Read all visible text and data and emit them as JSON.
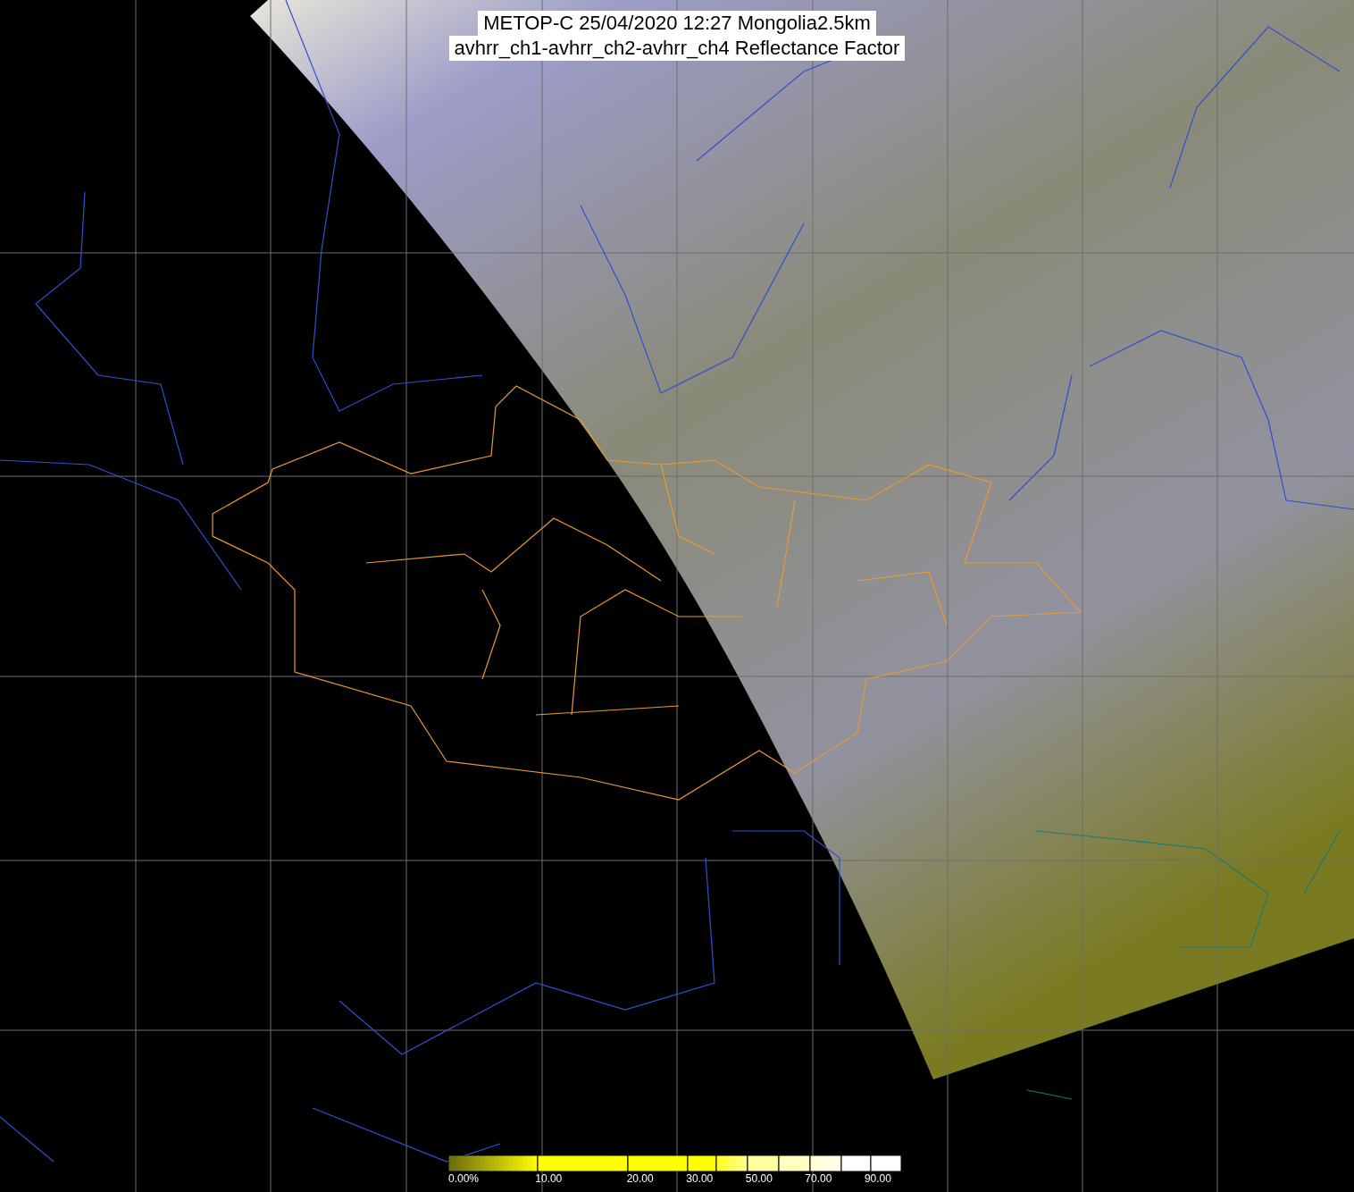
{
  "title": {
    "lines": [
      "METOP-C 25/04/2020 12:27 Mongolia2.5km",
      "avhrr_ch1-avhrr_ch2-avhrr_ch4 Reflectance Factor"
    ]
  },
  "colorbar": {
    "labels": [
      "0.00%",
      "10.00",
      "20.00",
      "30.00",
      "50.00",
      "70.00",
      "90.00"
    ]
  }
}
